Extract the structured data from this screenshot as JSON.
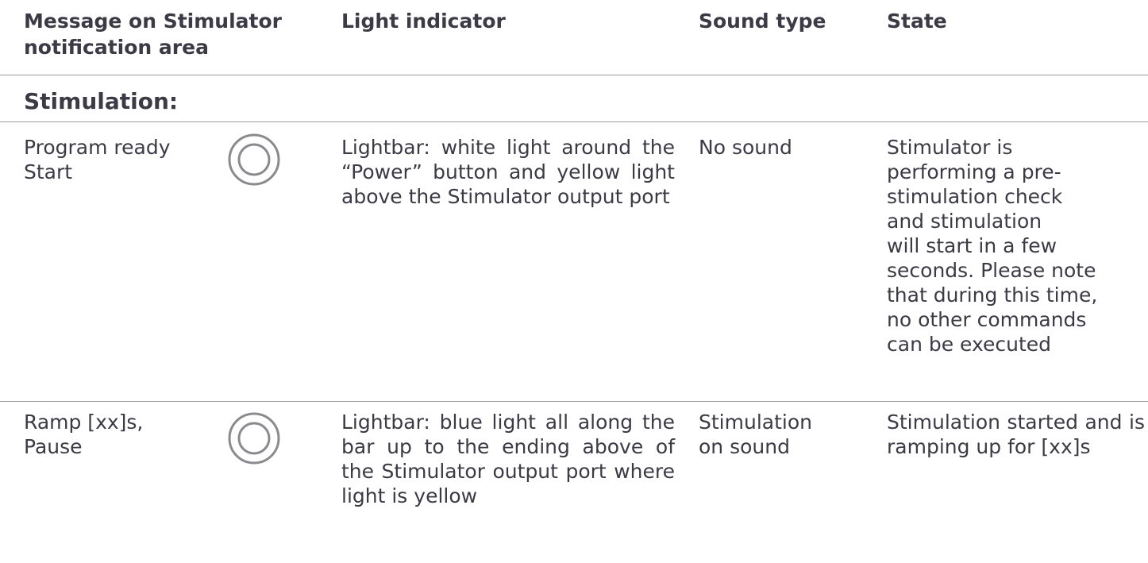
{
  "table": {
    "headers": {
      "message": [
        "Message on Stimulator",
        "notification area"
      ],
      "light": "Light indicator",
      "sound": "Sound type",
      "state": "State"
    },
    "section": "Stimulation:",
    "rows": [
      {
        "message": [
          "Program ready",
          "Start"
        ],
        "icon": "ring-indicator-icon",
        "light": "Lightbar: white light around the “Power” button and yellow light above the Stimulator output port",
        "sound": "No sound",
        "state": [
          "Stimulator is",
          "performing a pre-",
          "stimulation check",
          "and stimulation",
          "will start in a few",
          "seconds. Please note",
          "that during this time,",
          "no other commands",
          "can be executed"
        ]
      },
      {
        "message": [
          "Ramp [xx]s,",
          "Pause"
        ],
        "icon": "ring-indicator-icon",
        "light": "Lightbar: blue light all along the bar up to the ending above of the Stimulator output port where light is yellow",
        "sound": [
          "Stimulation",
          "on sound"
        ],
        "state": "Stimulation started and is ramping up for [xx]s"
      }
    ]
  },
  "colors": {
    "text": "#3b3a45",
    "rule": "#9a9aa0",
    "icon": "#8a8a8f"
  }
}
